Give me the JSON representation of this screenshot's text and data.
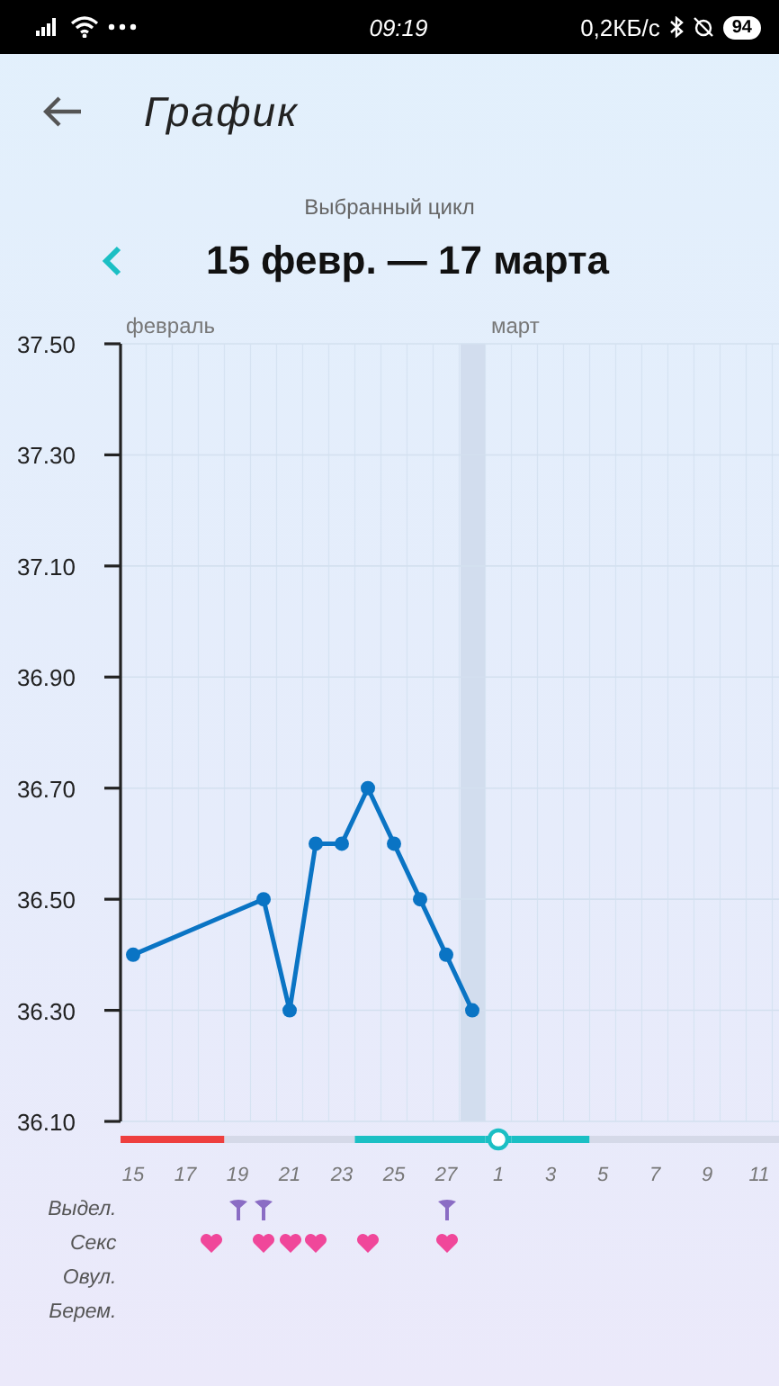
{
  "status_bar": {
    "time": "09:19",
    "speed": "0,2КБ/с",
    "battery": "94"
  },
  "header": {
    "title": "График"
  },
  "cycle": {
    "caption": "Выбранный цикл",
    "range": "15 февр. — 17 марта"
  },
  "chart_data": {
    "type": "line",
    "categories": [
      "15",
      null,
      "17",
      null,
      "19",
      null,
      "21",
      null,
      "23",
      null,
      "25",
      null,
      "27",
      null,
      "1",
      null,
      "3",
      null,
      "5",
      null,
      "7",
      null,
      "9",
      null,
      "11"
    ],
    "series": [
      {
        "color": "#0a74c4",
        "values": [
          36.4,
          null,
          null,
          null,
          null,
          36.5,
          36.3,
          36.6,
          36.6,
          36.7,
          36.6,
          36.5,
          36.4,
          36.3,
          null,
          null,
          null,
          null,
          null,
          null,
          null,
          null,
          null,
          null,
          null
        ]
      }
    ],
    "ylim": [
      36.1,
      37.5
    ],
    "yticks": [
      {
        "value": 36.1,
        "label": "36.10"
      },
      {
        "value": 36.3,
        "label": "36.30"
      },
      {
        "value": 36.5,
        "label": "36.50"
      },
      {
        "value": 36.7,
        "label": "36.70"
      },
      {
        "value": 36.9,
        "label": "36.90"
      },
      {
        "value": 37.1,
        "label": "37.10"
      },
      {
        "value": 37.3,
        "label": "37.30"
      },
      {
        "value": 37.5,
        "label": "37.50"
      }
    ],
    "grid": true,
    "marker": true
  },
  "cycle_days": [
    {
      "kind": "period",
      "month": "февраль"
    },
    {
      "kind": "period"
    },
    {
      "kind": "period"
    },
    {
      "kind": "period",
      "sex": true
    },
    {
      "kind": "none",
      "discharge": true
    },
    {
      "kind": "none",
      "discharge": true,
      "sex": true
    },
    {
      "kind": "none",
      "sex": true
    },
    {
      "kind": "none",
      "sex": true
    },
    {
      "kind": "none"
    },
    {
      "kind": "fertile",
      "sex": true
    },
    {
      "kind": "fertile"
    },
    {
      "kind": "fertile"
    },
    {
      "kind": "fertile",
      "discharge": true,
      "sex": true
    },
    {
      "kind": "fertile",
      "today": true
    },
    {
      "kind": "ovulation",
      "month": "март"
    },
    {
      "kind": "fertile"
    },
    {
      "kind": "fertile"
    },
    {
      "kind": "fertile"
    },
    {
      "kind": "none"
    },
    {
      "kind": "none"
    },
    {
      "kind": "none"
    },
    {
      "kind": "none"
    },
    {
      "kind": "none"
    },
    {
      "kind": "none"
    },
    {
      "kind": "none"
    }
  ],
  "event_rows": [
    {
      "label": "Выдел.",
      "kind": "discharge"
    },
    {
      "label": "Секс",
      "kind": "sex"
    },
    {
      "label": "Овул.",
      "kind": "ovulation"
    },
    {
      "label": "Берем.",
      "kind": "pregnancy"
    }
  ]
}
